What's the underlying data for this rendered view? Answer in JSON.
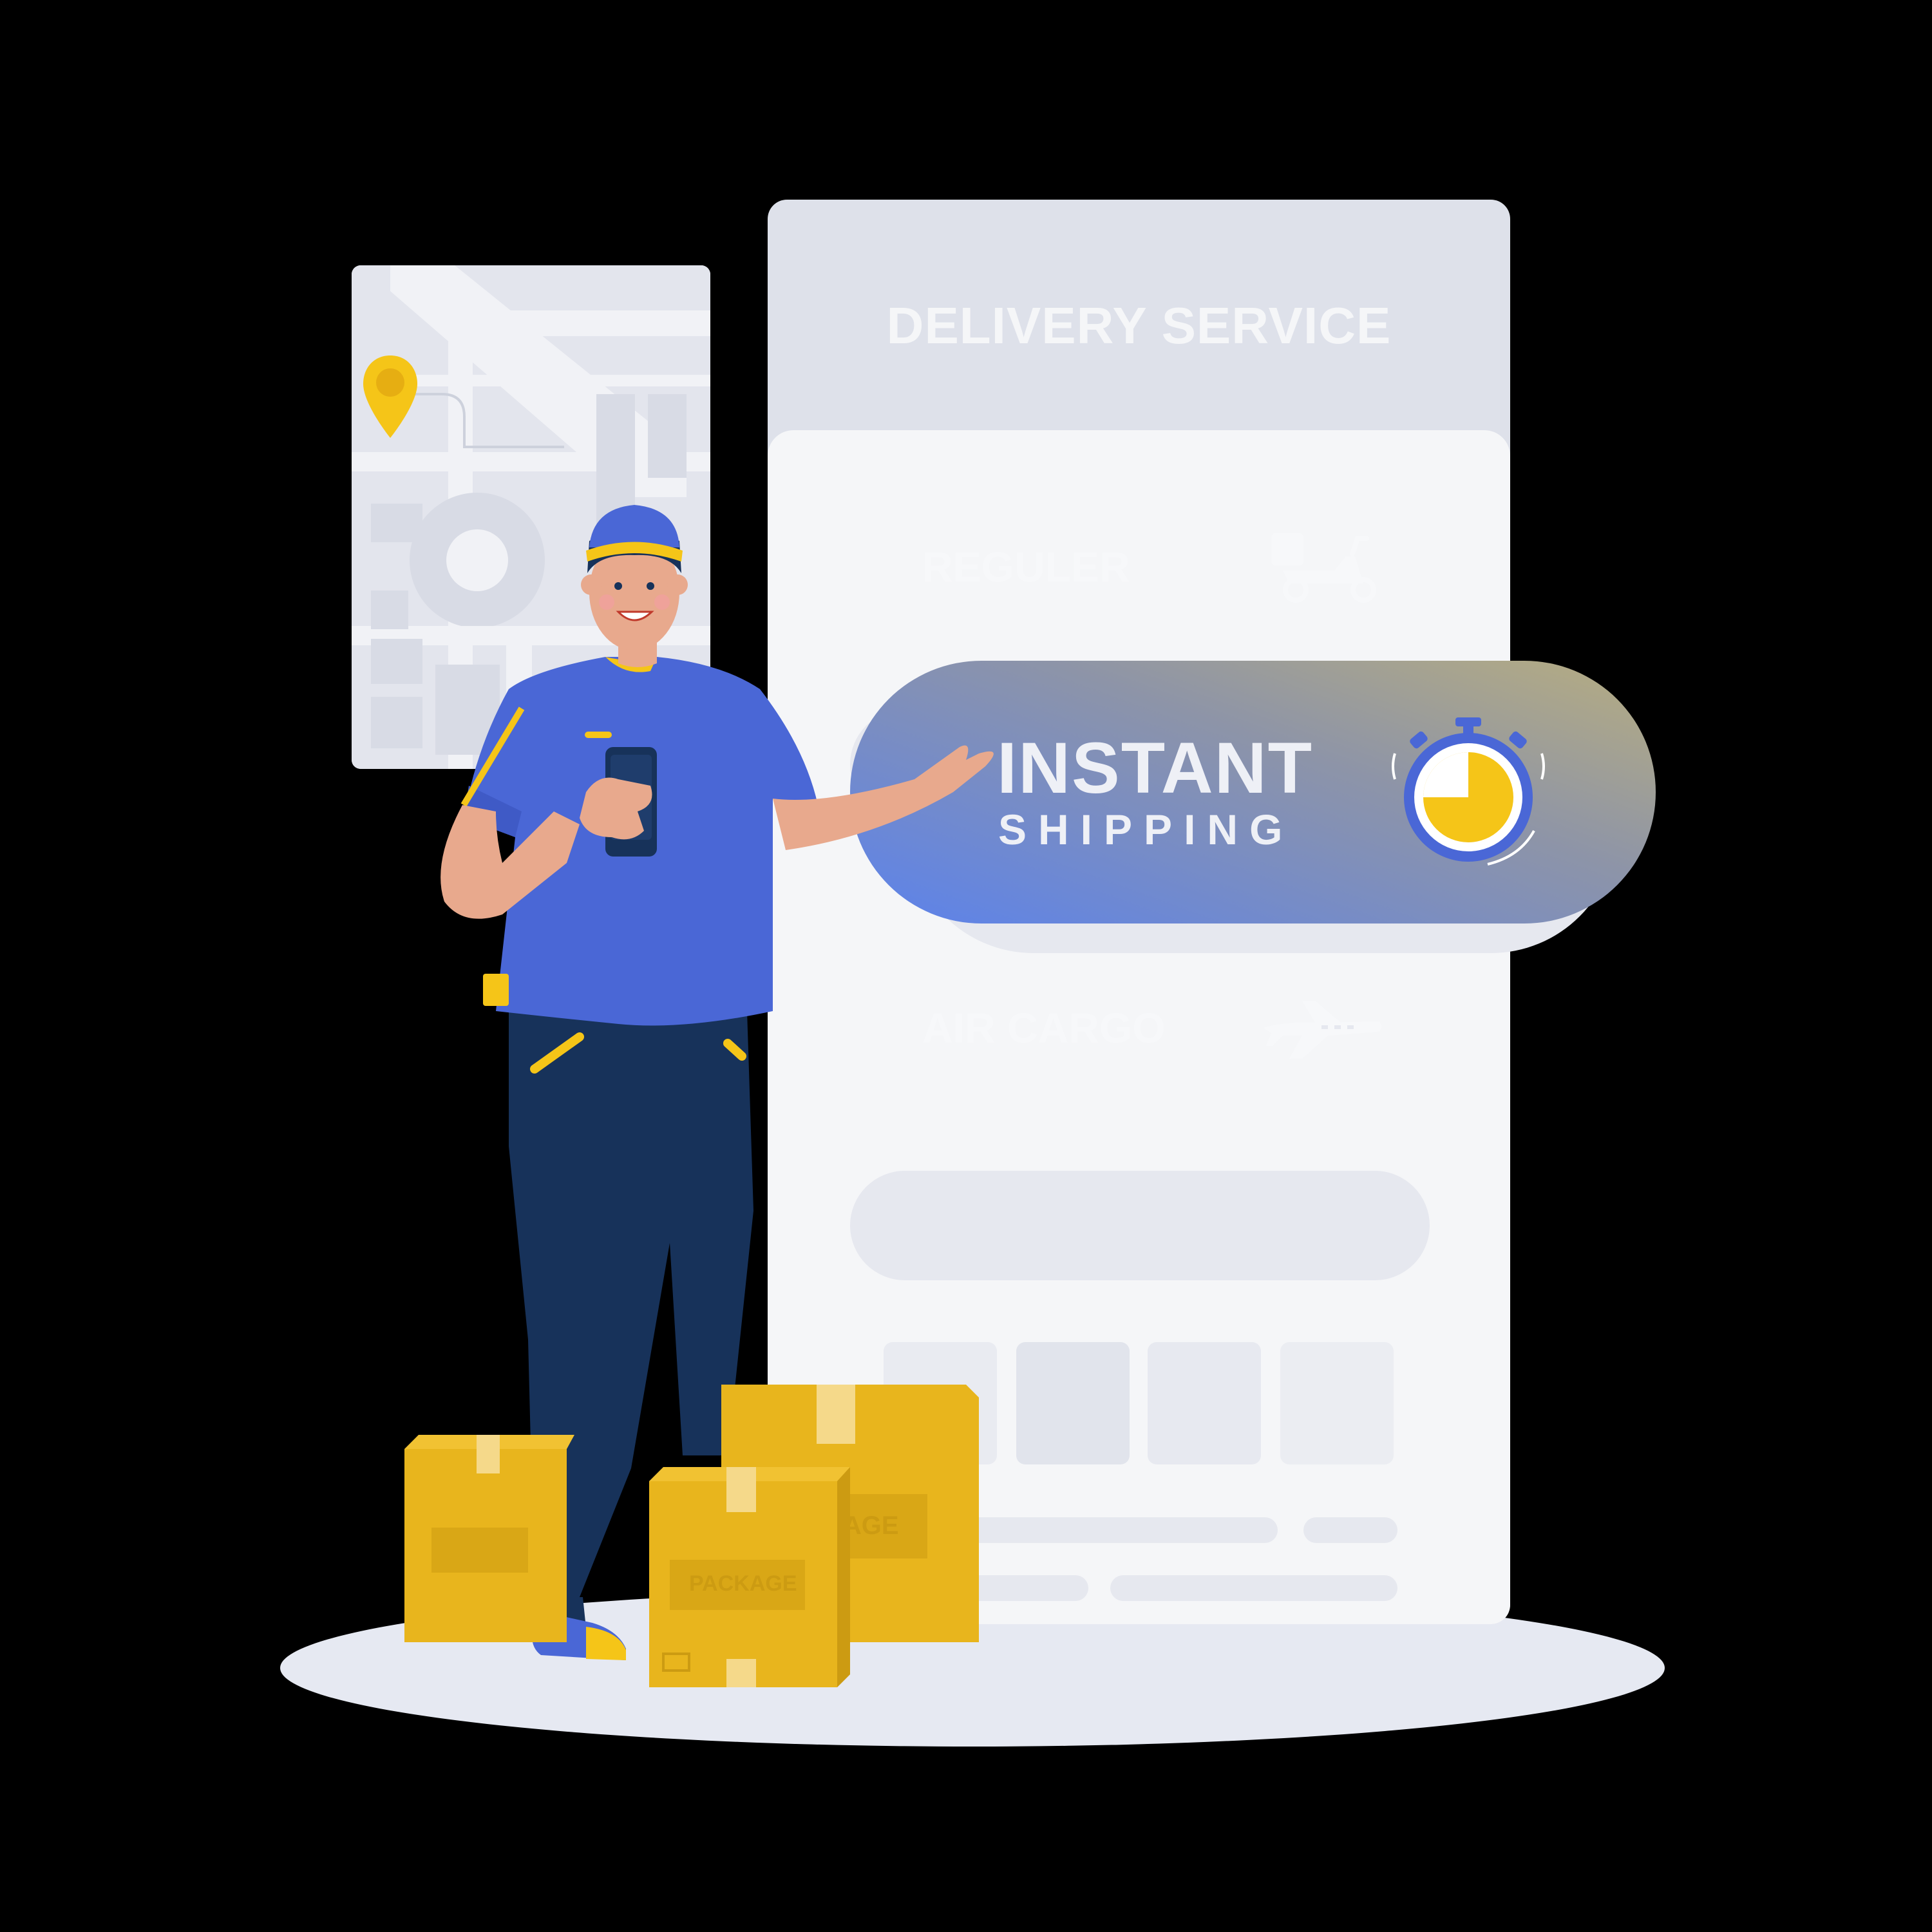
{
  "app": {
    "title": "DELIVERY SERVICE",
    "options": [
      {
        "label": "REGULER",
        "icon": "scooter-icon"
      },
      {
        "label": "INSTANT",
        "sublabel": "SHIPPING",
        "icon": "stopwatch-icon",
        "selected": true
      },
      {
        "label": "AIR CARGO",
        "icon": "airplane-icon"
      }
    ]
  },
  "map": {
    "icon": "location-pin-icon"
  },
  "packages": {
    "label": "PACKAGE"
  },
  "colors": {
    "accent_yellow": "#f5c518",
    "brand_blue": "#4a67d6",
    "panel_bg": "#dee1ea",
    "panel_body": "#f5f6f8"
  }
}
